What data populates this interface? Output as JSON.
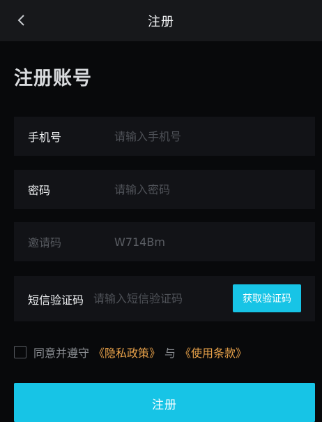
{
  "header": {
    "title": "注册",
    "back_icon": "chevron-left-icon"
  },
  "heading": "注册账号",
  "form": {
    "phone": {
      "label": "手机号",
      "placeholder": "请输入手机号",
      "value": ""
    },
    "password": {
      "label": "密码",
      "placeholder": "请输入密码",
      "value": ""
    },
    "invite": {
      "label": "邀请码",
      "value": "W714Bm"
    },
    "sms": {
      "label": "短信验证码",
      "placeholder": "请输入短信验证码",
      "value": "",
      "button": "获取验证码"
    }
  },
  "agreement": {
    "checked": false,
    "prefix": "同意并遵守",
    "privacy_link": "《隐私政策》",
    "joiner": "与",
    "terms_link": "《使用条款》"
  },
  "submit_label": "注册",
  "colors": {
    "accent": "#17c4e6",
    "link": "#e9a24a",
    "background": "#08090b",
    "field": "#121317"
  }
}
